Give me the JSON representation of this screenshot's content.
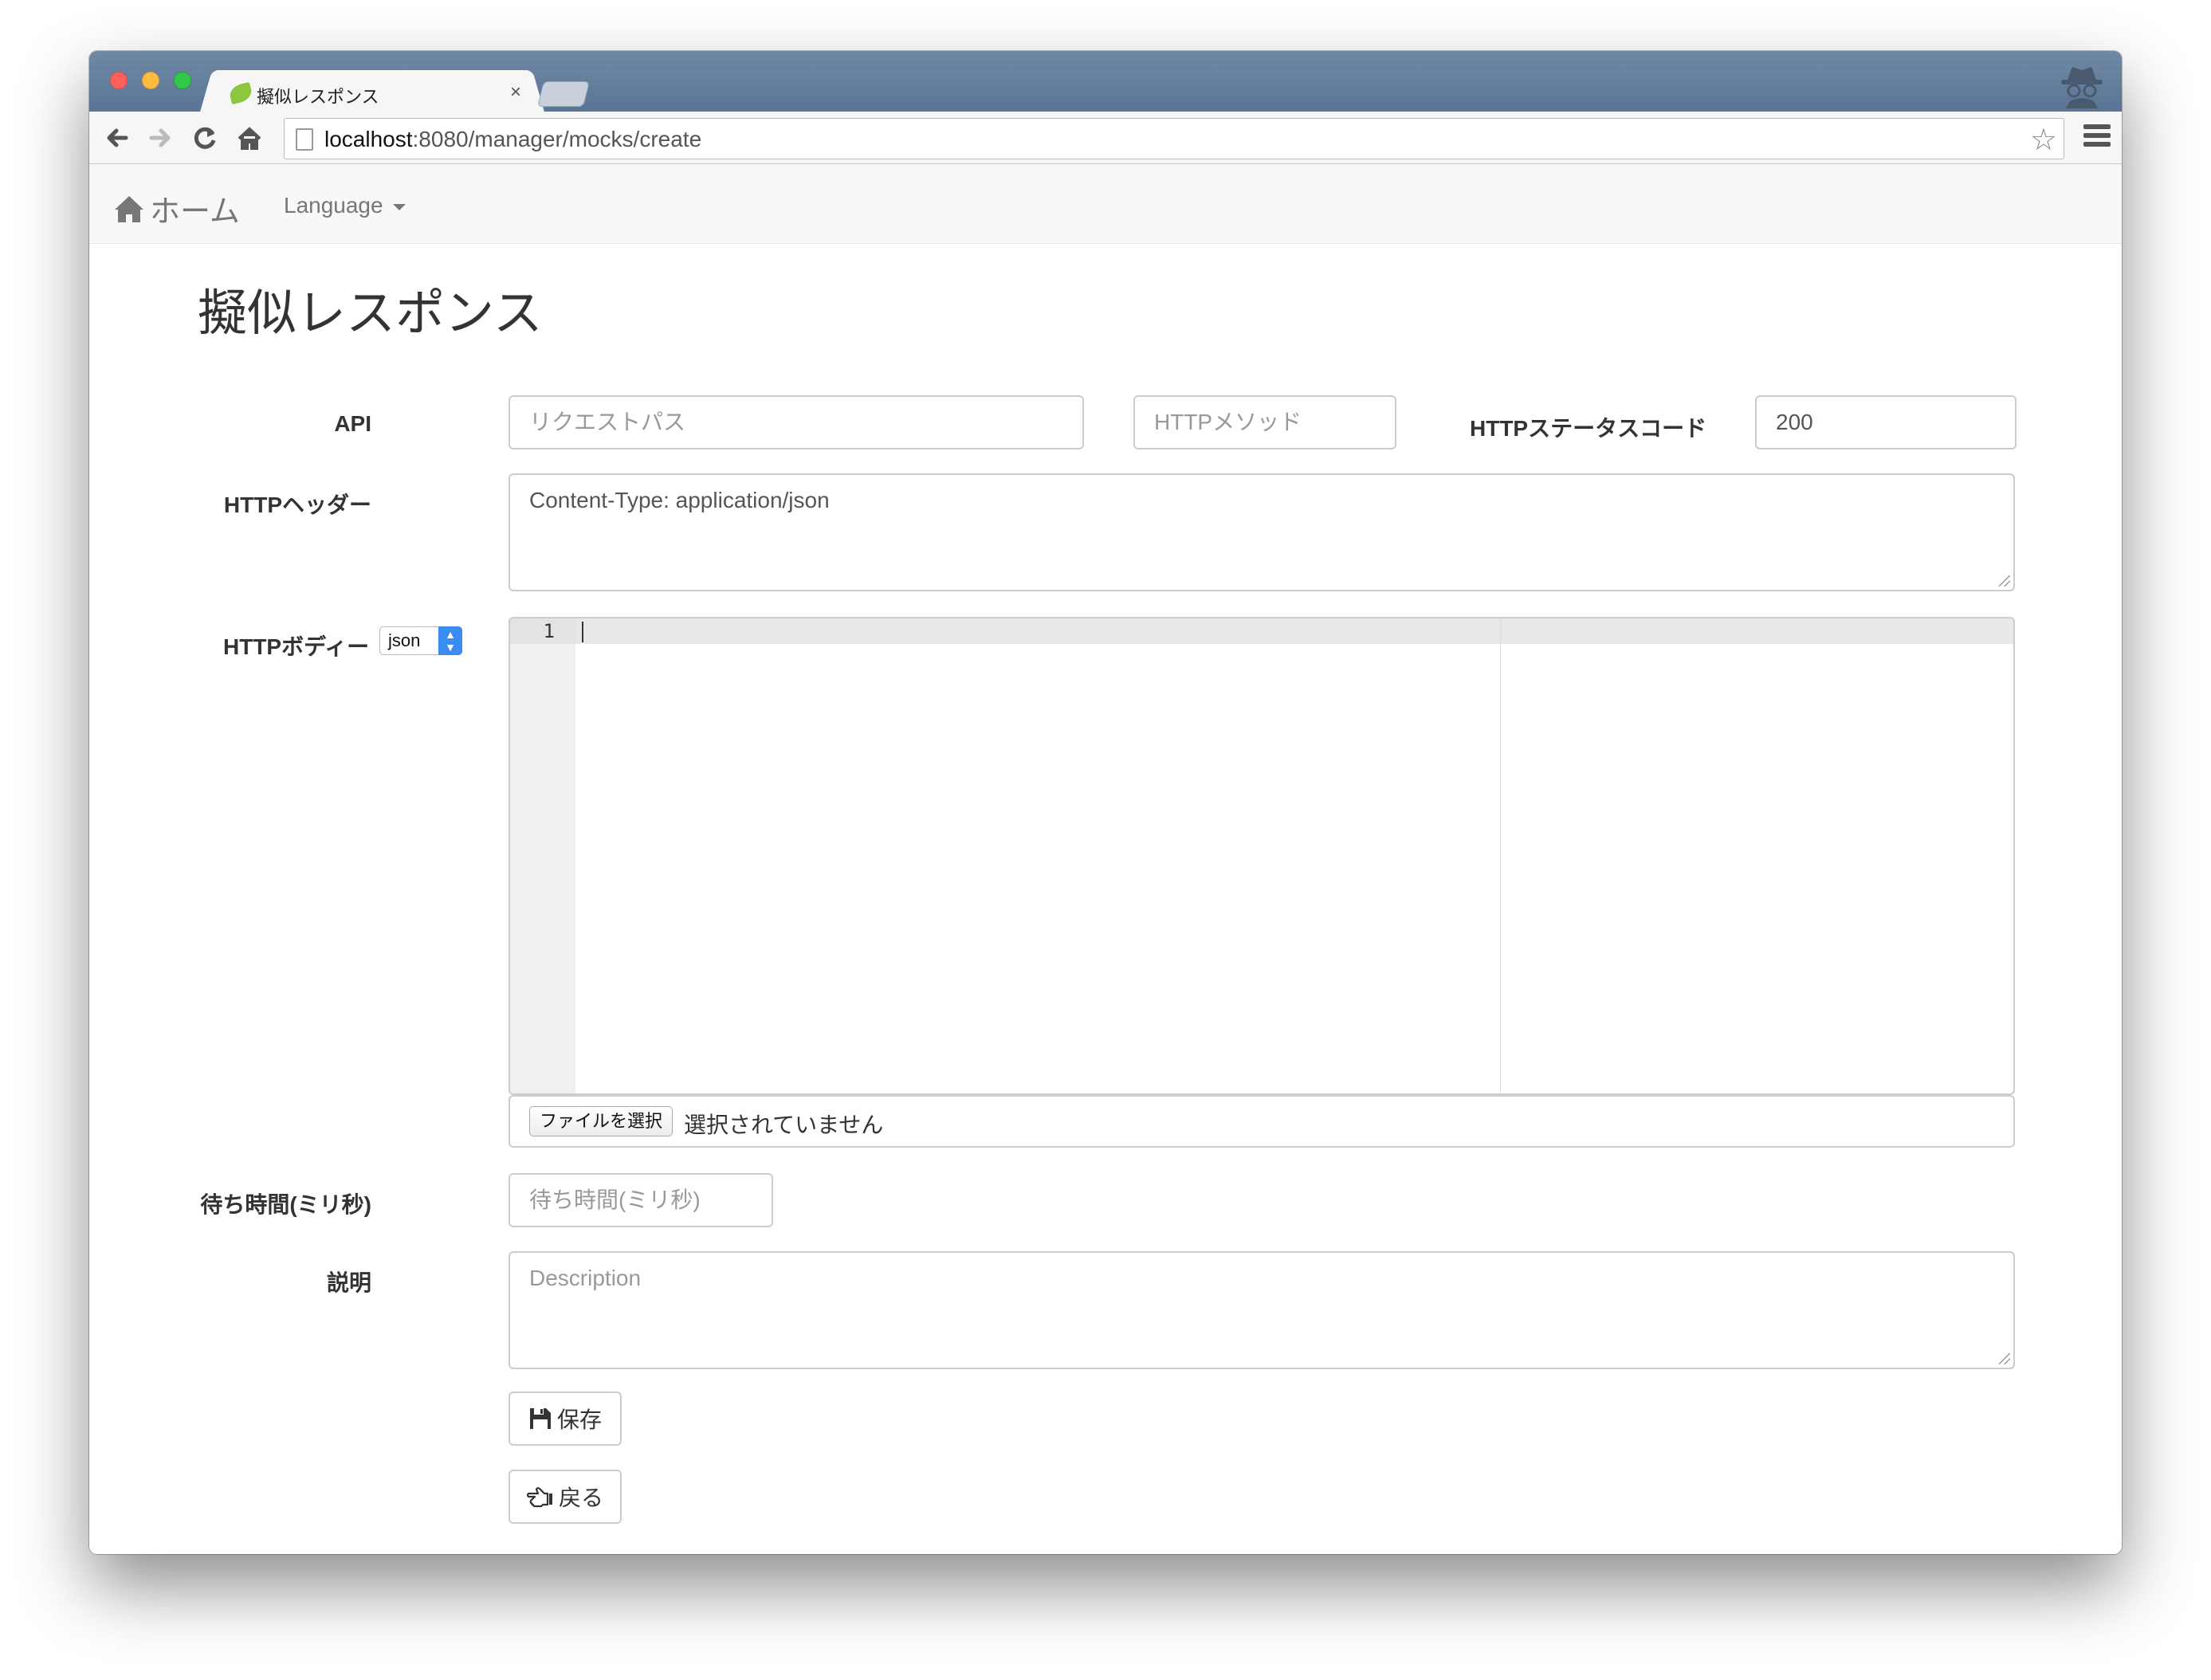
{
  "browser": {
    "tab_title": "擬似レスポンス",
    "tab_close": "×",
    "url_host": "localhost",
    "url_path": ":8080/manager/mocks/create"
  },
  "navbar": {
    "brand": "ホーム",
    "language": "Language"
  },
  "page": {
    "heading": "擬似レスポンス"
  },
  "form": {
    "api_label": "API",
    "request_path_placeholder": "リクエストパス",
    "http_method_placeholder": "HTTPメソッド",
    "status_label": "HTTPステータスコード",
    "status_value": "200",
    "headers_label": "HTTPヘッダー",
    "headers_value": "Content-Type: application/json",
    "body_label": "HTTPボディー",
    "body_format": "json",
    "editor_line_number": "1",
    "file_button": "ファイルを選択",
    "file_status": "選択されていません",
    "wait_label": "待ち時間(ミリ秒)",
    "wait_placeholder": "待ち時間(ミリ秒)",
    "description_label": "説明",
    "description_placeholder": "Description",
    "save_button": "保存",
    "back_button": "戻る"
  },
  "icons": {
    "home": "home-icon",
    "save": "floppy-icon",
    "back": "hand-left-icon"
  }
}
